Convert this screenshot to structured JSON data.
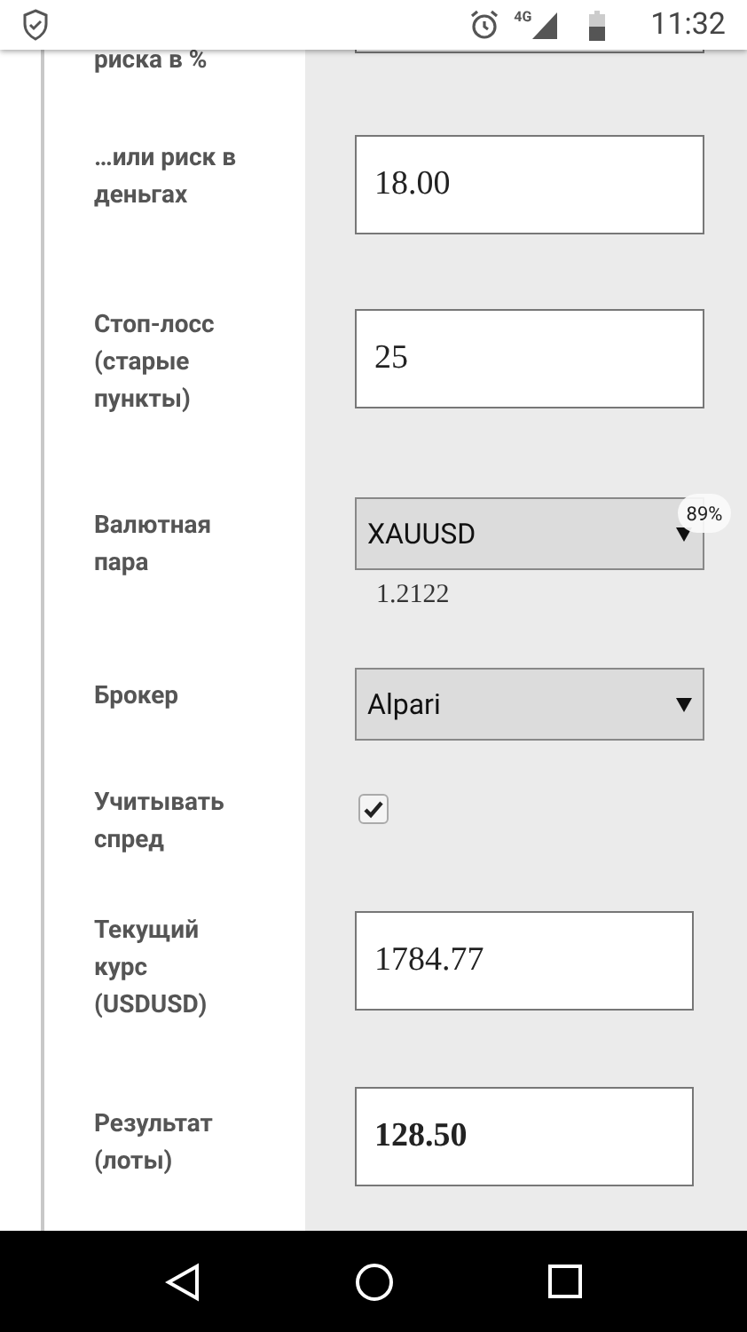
{
  "status_bar": {
    "time": "11:32",
    "network": "4G"
  },
  "form": {
    "rows": [
      {
        "kind": "cut",
        "label": "риска в %"
      },
      {
        "kind": "input",
        "label": "…или риск в деньгах",
        "value": "18.00",
        "bold": false
      },
      {
        "kind": "input",
        "label": "Стоп-лосс (старые пункты)",
        "value": "25",
        "bold": false
      },
      {
        "kind": "select",
        "label": "Валютная пара",
        "value": "XAUUSD",
        "note": "1.2122",
        "badge": "89%"
      },
      {
        "kind": "select",
        "label": "Брокер",
        "value": "Alpari"
      },
      {
        "kind": "checkbox",
        "label": "Учитывать спред",
        "checked": true
      },
      {
        "kind": "input",
        "label": "Текущий курс (USDUSD)",
        "value": "1784.77",
        "bold": false
      },
      {
        "kind": "input",
        "label": "Результат (лоты)",
        "value": "128.50",
        "bold": true
      }
    ]
  }
}
